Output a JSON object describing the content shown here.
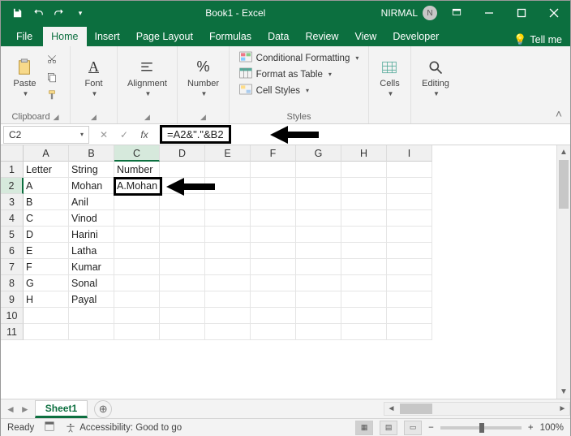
{
  "titlebar": {
    "doc_title": "Book1 - Excel",
    "username": "NIRMAL",
    "avatar_initial": "N"
  },
  "tabs": {
    "file": "File",
    "home": "Home",
    "insert": "Insert",
    "pagelayout": "Page Layout",
    "formulas": "Formulas",
    "data": "Data",
    "review": "Review",
    "view": "View",
    "developer": "Developer",
    "tellme": "Tell me"
  },
  "ribbon": {
    "paste": "Paste",
    "clipboard": "Clipboard",
    "font": "Font",
    "alignment": "Alignment",
    "number": "Number",
    "cond_format": "Conditional Formatting",
    "format_table": "Format as Table",
    "cell_styles": "Cell Styles",
    "styles": "Styles",
    "cells": "Cells",
    "editing": "Editing"
  },
  "formula": {
    "name_box": "C2",
    "formula_text": "=A2&\".\"&B2"
  },
  "columns": [
    "A",
    "B",
    "C",
    "D",
    "E",
    "F",
    "G",
    "H",
    "I"
  ],
  "rows": [
    "1",
    "2",
    "3",
    "4",
    "5",
    "6",
    "7",
    "8",
    "9",
    "10",
    "11"
  ],
  "cells": {
    "A1": "Letter",
    "B1": "String",
    "C1": "Number",
    "A2": "A",
    "B2": "Mohan",
    "C2": "A.Mohan",
    "A3": "B",
    "B3": "Anil",
    "A4": "C",
    "B4": "Vinod",
    "A5": "D",
    "B5": "Harini",
    "A6": "E",
    "B6": "Latha",
    "A7": "F",
    "B7": "Kumar",
    "A8": "G",
    "B8": "Sonal",
    "A9": "H",
    "B9": "Payal"
  },
  "sheets": {
    "active": "Sheet1"
  },
  "status": {
    "ready": "Ready",
    "accessibility": "Accessibility: Good to go",
    "zoom": "100%"
  }
}
